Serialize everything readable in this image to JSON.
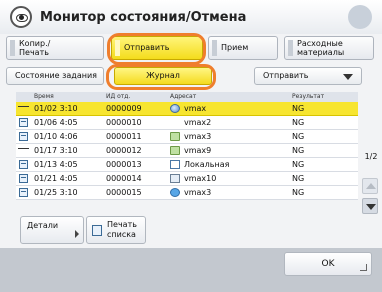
{
  "window": {
    "title": "Монитор состояния/Отмена"
  },
  "tabs": [
    {
      "label": "Копир./\nПечать",
      "selected": false
    },
    {
      "label": "Отправить",
      "selected": true
    },
    {
      "label": "Прием",
      "selected": false
    },
    {
      "label": "Расходные\nматериалы",
      "selected": false
    }
  ],
  "subbar": {
    "status_label": "Состояние задания",
    "journal_label": "Журнал",
    "dropdown_value": "Отправить"
  },
  "table": {
    "columns": [
      "Время",
      "ИД отд.",
      "Адресат",
      "Результат"
    ],
    "rows": [
      {
        "time": "01/02 3:10",
        "id": "0000009",
        "addr": "vmax",
        "result": "NG",
        "icon": "disk-icon",
        "selected": true
      },
      {
        "time": "01/06 4:05",
        "id": "0000010",
        "addr": "vmax2",
        "result": "NG",
        "icon": "none"
      },
      {
        "time": "01/10 4:06",
        "id": "0000011",
        "addr": "vmax3",
        "result": "NG",
        "icon": "folder-icon"
      },
      {
        "time": "01/17 3:10",
        "id": "0000012",
        "addr": "vmax9",
        "result": "NG",
        "icon": "folder-icon"
      },
      {
        "time": "01/13 4:05",
        "id": "0000013",
        "addr": "Локальная",
        "result": "NG",
        "icon": "file-icon"
      },
      {
        "time": "01/21 4:05",
        "id": "0000014",
        "addr": "vmax10",
        "result": "NG",
        "icon": "mail-icon"
      },
      {
        "time": "01/25 3:10",
        "id": "0000015",
        "addr": "vmax3",
        "result": "NG",
        "icon": "arrows-icon"
      }
    ]
  },
  "pagination": {
    "page": "1/2"
  },
  "buttons": {
    "details": "Детали",
    "print_list": "Печать\nсписка",
    "ok": "OK"
  },
  "colors": {
    "accent_yellow": "#f4dc1c",
    "highlight_ring": "#ef7e2d"
  }
}
